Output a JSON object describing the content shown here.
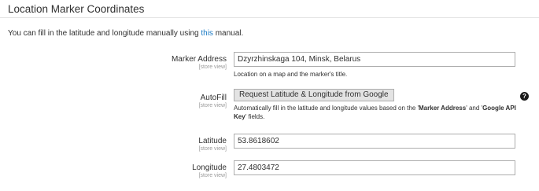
{
  "section": {
    "title": "Location Marker Coordinates"
  },
  "intro": {
    "text_before": "You can fill in the latitude and longitude manually using ",
    "link": "this",
    "text_after": " manual."
  },
  "fields": {
    "marker_address": {
      "label": "Marker Address",
      "scope": "[store view]",
      "value": "Dzyrzhinskaga 104, Minsk, Belarus",
      "note": "Location on a map and the marker's title."
    },
    "autofill": {
      "label": "AutoFill",
      "scope": "[store view]",
      "button": "Request Latitude & Longitude from Google",
      "help_icon": "?",
      "note_start": "Automatically fill in the latitude and longitude values based on the '",
      "note_bold_1": "Marker Address",
      "note_mid": "' and '",
      "note_bold_2": "Google API Key",
      "note_end": "' fields."
    },
    "latitude": {
      "label": "Latitude",
      "scope": "[store view]",
      "value": "53.8618602"
    },
    "longitude": {
      "label": "Longitude",
      "scope": "[store view]",
      "value": "27.4803472"
    }
  }
}
